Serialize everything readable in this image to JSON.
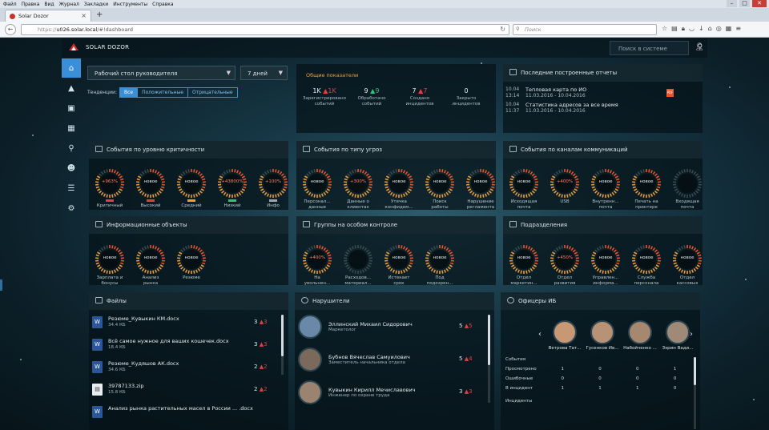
{
  "browser": {
    "menu": [
      "Файл",
      "Правка",
      "Вид",
      "Журнал",
      "Закладки",
      "Инструменты",
      "Справка"
    ],
    "tab_title": "Solar Dozor",
    "url_prefix": "https://",
    "url_host": "u026.solar.local",
    "url_path": "/#!dashboard",
    "search_placeholder": "Поиск"
  },
  "app": {
    "brand": "SOLAR DOZOR",
    "search_placeholder": "Поиск в системе"
  },
  "filters": {
    "desk": "Рабочий стол руководителя",
    "period": "7 дней",
    "tend_label": "Тенденции:",
    "tend": [
      "Все",
      "Положительные",
      "Отрицательные"
    ]
  },
  "summary": {
    "title": "Общие показатели",
    "metrics": [
      {
        "v": "1K",
        "d": "1K",
        "dir": "red",
        "l1": "Зарегистрировано",
        "l2": "событий"
      },
      {
        "v": "9",
        "d": "9",
        "dir": "green",
        "l1": "Обработано",
        "l2": "событий"
      },
      {
        "v": "7",
        "d": "7",
        "dir": "red",
        "l1": "Создано",
        "l2": "инцидентов"
      },
      {
        "v": "0",
        "d": "",
        "dir": "",
        "l1": "Закрыто",
        "l2": "инцидентов"
      }
    ]
  },
  "reports": {
    "title": "Последние построенные отчеты",
    "items": [
      {
        "date": "10.04",
        "time": "13:14",
        "title": "Тепловая карта по ИО",
        "range": "11.03.2016 - 10.04.2016"
      },
      {
        "date": "10.04",
        "time": "11:37",
        "title": "Статистика адресов за все время",
        "range": "11.03.2016 - 10.04.2016"
      }
    ]
  },
  "crit": {
    "title": "События по уровню критичности",
    "gauges": [
      {
        "v": "+963%",
        "l1": "Критичный",
        "l2": "",
        "color": "#e24040"
      },
      {
        "v": "новое",
        "l1": "Высокий",
        "l2": "",
        "color": "#e24040"
      },
      {
        "v": "новое",
        "l1": "Средний",
        "l2": "",
        "color": "#e8a42c"
      },
      {
        "v": "+43800%",
        "l1": "Низкий",
        "l2": "",
        "color": "#2fc27a"
      },
      {
        "v": "+100%",
        "l1": "Инфо",
        "l2": "",
        "color": "#9aa8ad"
      }
    ]
  },
  "threats": {
    "title": "События по типу угроз",
    "gauges": [
      {
        "v": "новое",
        "l1": "Персонал...",
        "l2": "данные"
      },
      {
        "v": "+300%",
        "l1": "Данные о",
        "l2": "клиентах"
      },
      {
        "v": "новое",
        "l1": "Утечка",
        "l2": "конфидем..."
      },
      {
        "v": "новое",
        "l1": "Поиск",
        "l2": "работы"
      },
      {
        "v": "новое",
        "l1": "Нарушение",
        "l2": "регламента"
      }
    ]
  },
  "channels": {
    "title": "События по каналам коммуникаций",
    "gauges": [
      {
        "v": "новое",
        "l1": "Исходящая",
        "l2": "почта"
      },
      {
        "v": "+400%",
        "l1": "USB",
        "l2": ""
      },
      {
        "v": "новое",
        "l1": "Внутренн...",
        "l2": "почта"
      },
      {
        "v": "новое",
        "l1": "Печать на",
        "l2": "принтере"
      },
      {
        "v": "",
        "l1": "Входящая",
        "l2": "почта"
      }
    ]
  },
  "info": {
    "title": "Информационные объекты",
    "gauges": [
      {
        "v": "новое",
        "l1": "Зарплата и",
        "l2": "бонусы"
      },
      {
        "v": "новое",
        "l1": "Анализ",
        "l2": "рынка"
      },
      {
        "v": "новое",
        "l1": "Резюме",
        "l2": ""
      }
    ]
  },
  "groups": {
    "title": "Группы на особом контроле",
    "gauges": [
      {
        "v": "+400%",
        "l1": "На",
        "l2": "увольнен..."
      },
      {
        "v": "",
        "l1": "Расходов...",
        "l2": "материал..."
      },
      {
        "v": "новое",
        "l1": "Истекает",
        "l2": "срок"
      },
      {
        "v": "новое",
        "l1": "Под",
        "l2": "подозрен..."
      }
    ]
  },
  "depts": {
    "title": "Подразделения",
    "gauges": [
      {
        "v": "новое",
        "l1": "Отдел",
        "l2": "маркетин..."
      },
      {
        "v": "+450%",
        "l1": "Отдел",
        "l2": "развития"
      },
      {
        "v": "новое",
        "l1": "Управлен...",
        "l2": "информа..."
      },
      {
        "v": "новое",
        "l1": "Служба",
        "l2": "персонала"
      },
      {
        "v": "новое",
        "l1": "Отдел",
        "l2": "кассовых"
      }
    ]
  },
  "files": {
    "title": "Файлы",
    "items": [
      {
        "name": "Резюме_Кувыкин КМ.docx",
        "size": "34.4 КБ",
        "n": "3",
        "d": "3",
        "type": "W"
      },
      {
        "name": "Всё самое нужное для ваших кошечек.docx",
        "size": "18.4 КБ",
        "n": "3",
        "d": "3",
        "type": "W"
      },
      {
        "name": "Резюме_Кудяшов АК.docx",
        "size": "34.6 КБ",
        "n": "2",
        "d": "2",
        "type": "W"
      },
      {
        "name": "39787133.zip",
        "size": "15.8 КБ",
        "n": "2",
        "d": "2",
        "type": "Z"
      },
      {
        "name": "Анализ рынка растительных масел в России ... .docx",
        "size": "",
        "n": "",
        "d": "",
        "type": "W"
      }
    ]
  },
  "violators": {
    "title": "Нарушители",
    "items": [
      {
        "name": "Эллинский Михаил Сидорович",
        "pos": "Маркетолог",
        "n": "5",
        "d": "5"
      },
      {
        "name": "Бубнов Вячеслав Самуилович",
        "pos": "Заместитель начальника отдела",
        "n": "5",
        "d": "4"
      },
      {
        "name": "Кувыкин Кирилл Мечиславович",
        "pos": "Инженер по охране труда",
        "n": "3",
        "d": "3"
      }
    ]
  },
  "officers": {
    "title": "Офицеры ИБ",
    "people": [
      "Ветрова Тат...",
      "Гусенков Ив...",
      "Набойченко ...",
      "Зэрин Вади..."
    ],
    "events_label": "События",
    "rows": [
      {
        "label": "Просмотрено",
        "vals": [
          "1",
          "0",
          "0",
          "1"
        ]
      },
      {
        "label": "Ошибочные",
        "vals": [
          "0",
          "0",
          "0",
          "0"
        ]
      },
      {
        "label": "В инцидент",
        "vals": [
          "1",
          "1",
          "1",
          "0"
        ]
      }
    ],
    "incidents_label": "Инциденты"
  }
}
